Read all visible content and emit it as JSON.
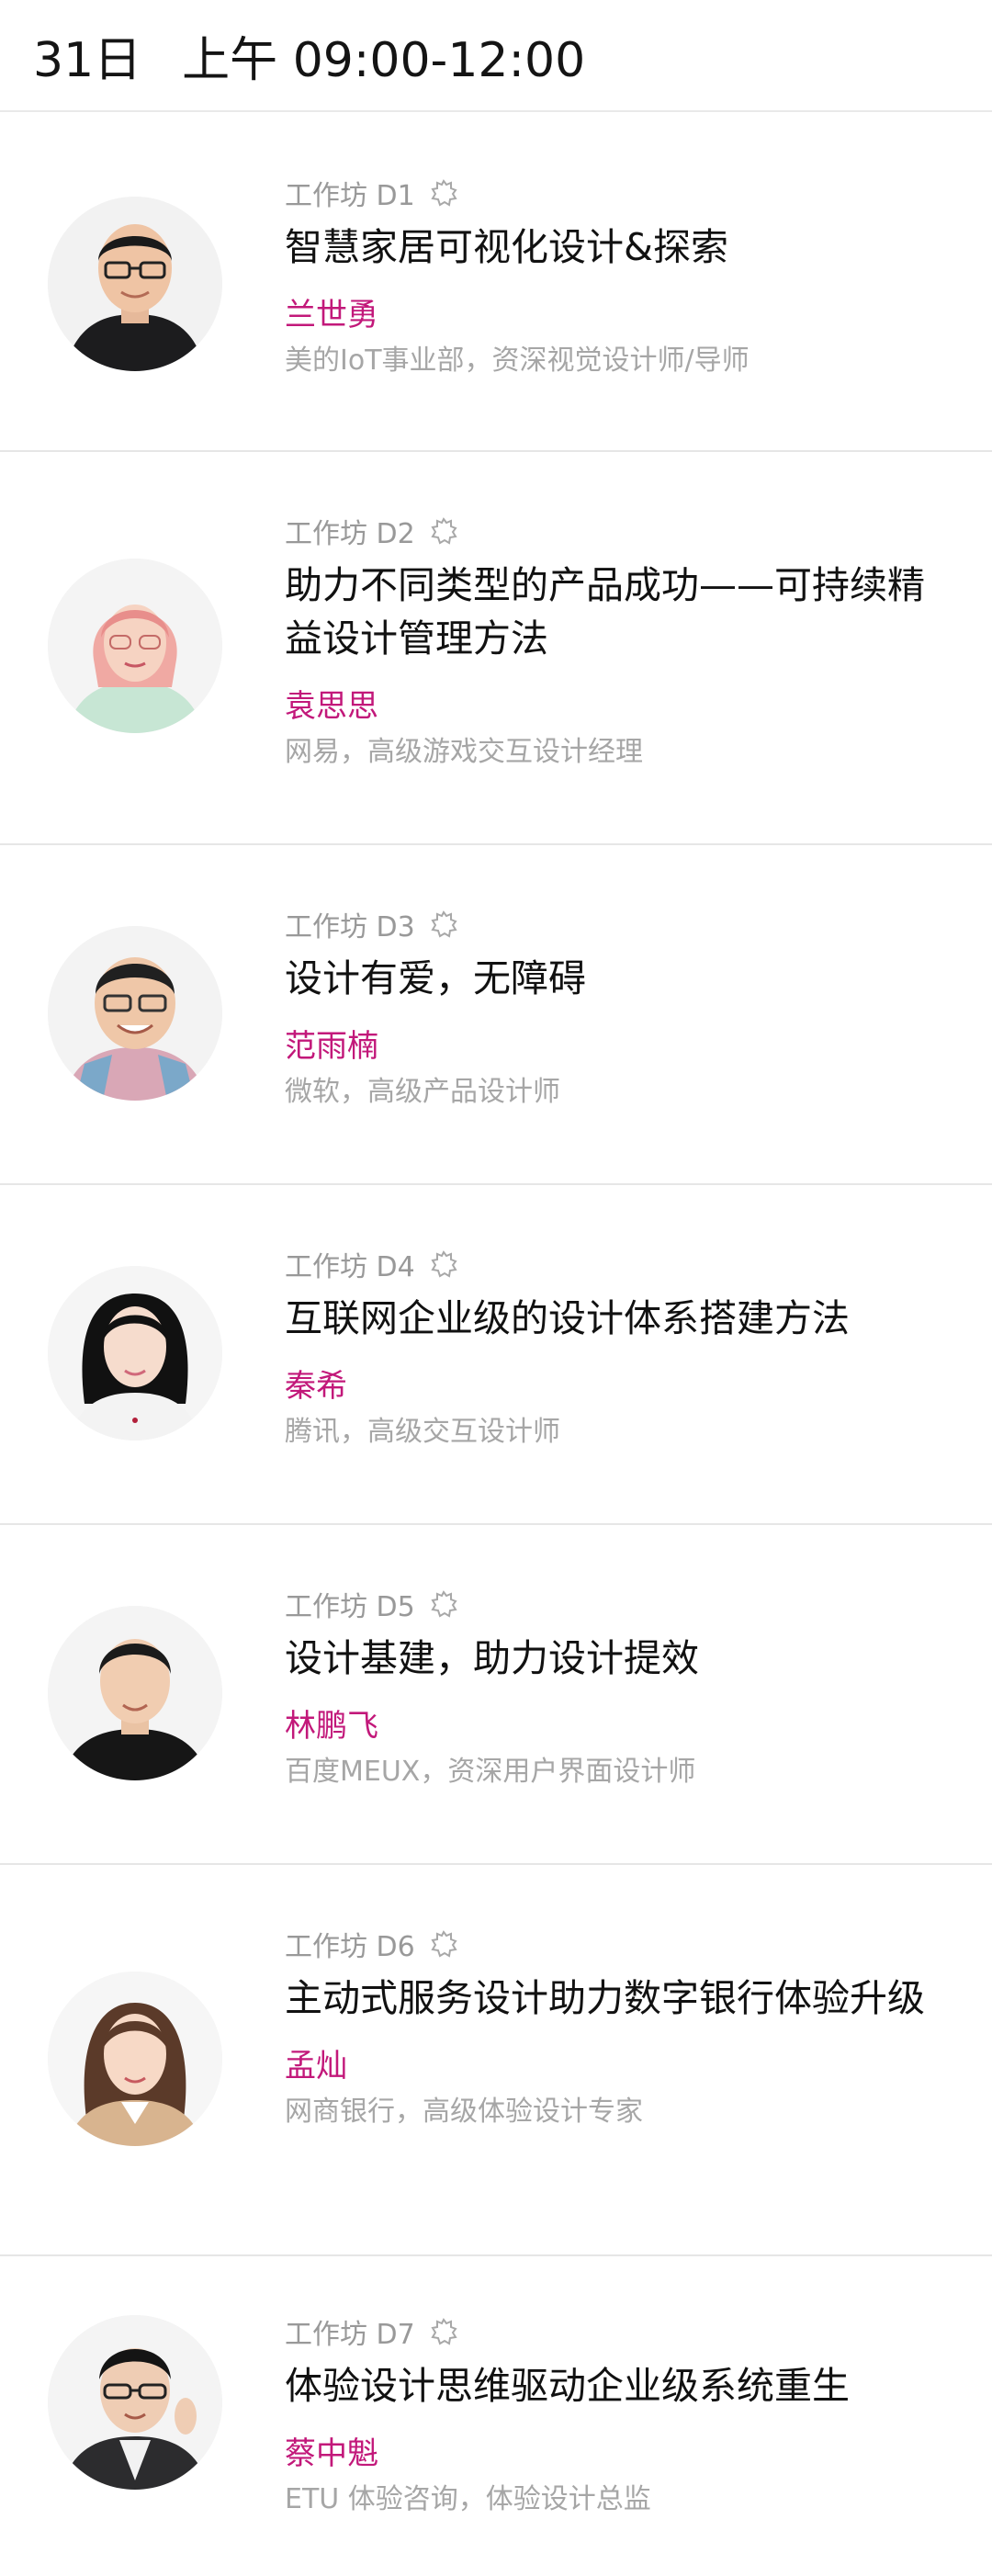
{
  "header": {
    "day": "31日",
    "session": "上午 09:00-12:00"
  },
  "sessions": [
    {
      "tag": "工作坊 D1",
      "title": "智慧家居可视化设计&探索",
      "speaker": "兰世勇",
      "org": "美的IoT事业部，资深视觉设计师/导师"
    },
    {
      "tag": "工作坊 D2",
      "title": "助力不同类型的产品成功——可持续精益设计管理方法",
      "speaker": "袁思思",
      "org": "网易，高级游戏交互设计经理"
    },
    {
      "tag": "工作坊 D3",
      "title": "设计有爱，无障碍",
      "speaker": "范雨楠",
      "org": "微软，高级产品设计师"
    },
    {
      "tag": "工作坊 D4",
      "title": "互联网企业级的设计体系搭建方法",
      "speaker": "秦希",
      "org": "腾讯，高级交互设计师"
    },
    {
      "tag": "工作坊 D5",
      "title": "设计基建，助力设计提效",
      "speaker": "林鹏飞",
      "org": "百度MEUX，资深用户界面设计师"
    },
    {
      "tag": "工作坊 D6",
      "title": "主动式服务设计助力数字银行体验升级",
      "speaker": "孟灿",
      "org": "网商银行，高级体验设计专家"
    },
    {
      "tag": "工作坊 D7",
      "title": "体验设计思维驱动企业级系统重生",
      "speaker": "蔡中魁",
      "org": "ETU 体验咨询，体验设计总监"
    }
  ],
  "colors": {
    "speaker": "#c2187a",
    "muted": "#a6a6a6",
    "divider": "#e6e6e6"
  },
  "icons": {
    "workshop": "workshop-badge-icon",
    "avatar": "speaker-photo"
  }
}
